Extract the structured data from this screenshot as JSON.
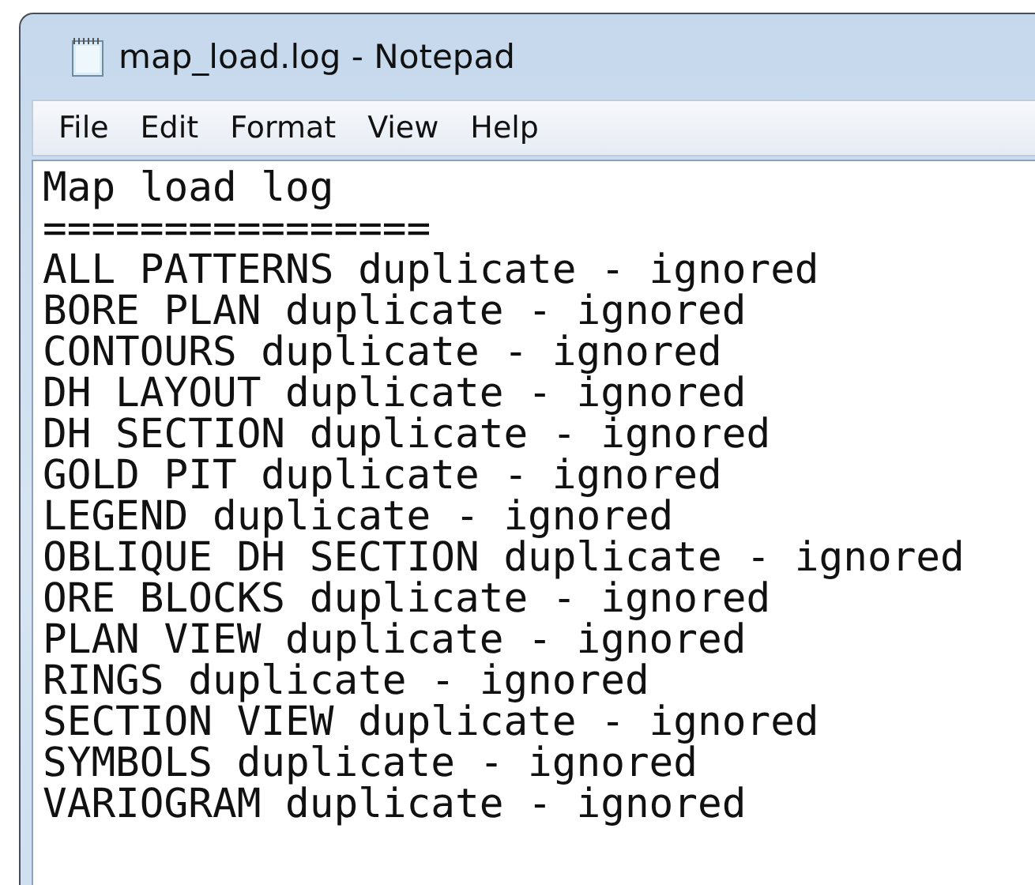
{
  "window": {
    "title": "map_load.log - Notepad"
  },
  "menu": [
    {
      "label": "File"
    },
    {
      "label": "Edit"
    },
    {
      "label": "Format"
    },
    {
      "label": "View"
    },
    {
      "label": "Help"
    }
  ],
  "editor": {
    "lines": [
      "Map load log",
      "================",
      "ALL PATTERNS duplicate - ignored",
      "BORE PLAN duplicate - ignored",
      "CONTOURS duplicate - ignored",
      "DH LAYOUT duplicate - ignored",
      "DH SECTION duplicate - ignored",
      "GOLD PIT duplicate - ignored",
      "LEGEND duplicate - ignored",
      "OBLIQUE DH SECTION duplicate - ignored",
      "ORE BLOCKS duplicate - ignored",
      "PLAN VIEW duplicate - ignored",
      "RINGS duplicate - ignored",
      "SECTION VIEW duplicate - ignored",
      "SYMBOLS duplicate - ignored",
      "VARIOGRAM duplicate - ignored"
    ]
  }
}
